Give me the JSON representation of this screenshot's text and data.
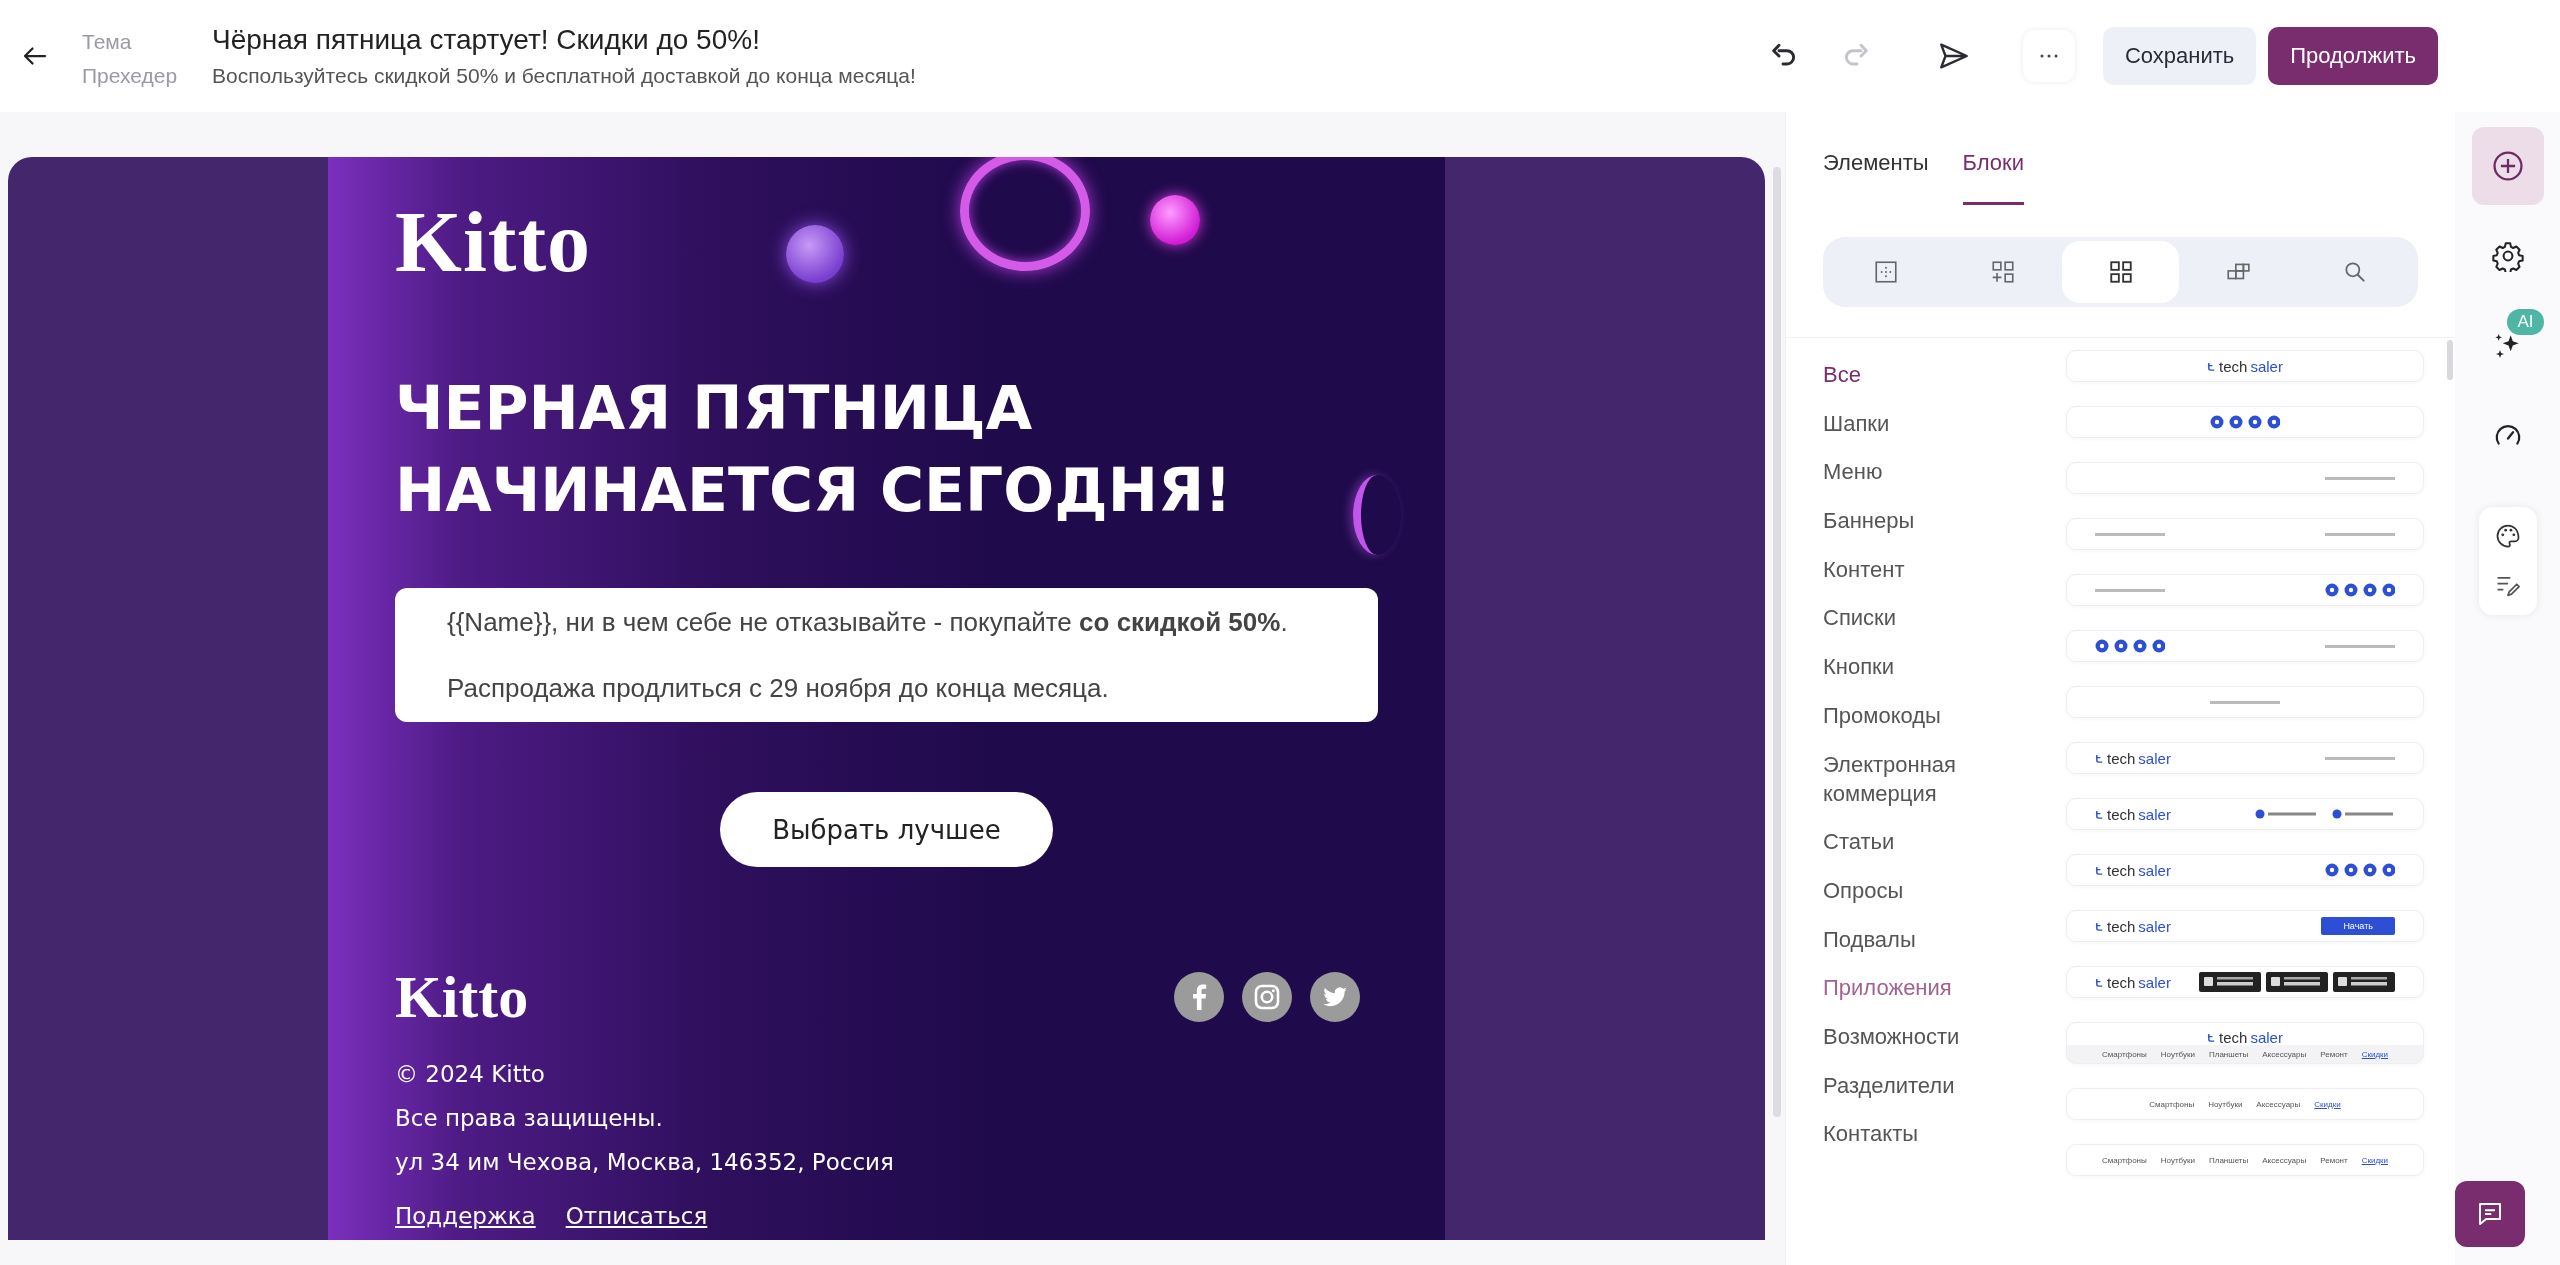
{
  "header": {
    "fields": [
      {
        "label": "Тема",
        "value": "Чёрная пятница стартует! Скидки до 50%!",
        "kind": "title"
      },
      {
        "label": "Прехедер",
        "value": "Воспользуйтесь скидкой 50% и бесплатной доставкой до конца месяца!",
        "kind": "preheader"
      }
    ],
    "history": [
      {
        "kind": "undo",
        "disabled": false
      },
      {
        "kind": "redo",
        "disabled": true
      }
    ],
    "buttons": [
      {
        "label": "Сохранить",
        "kind": "secondary"
      },
      {
        "label": "Продолжить",
        "kind": "primary"
      }
    ]
  },
  "email": {
    "logo": "Kitto",
    "headline": "ЧЕРНАЯ ПЯТНИЦА НАЧИНАЕТСЯ СЕГОДНЯ!",
    "message": [
      "{{Name}}, ни в чем себе не отказывайте - покупайте **со скидкой 50%**.",
      "Распродажа продлиться с 29 ноября до конца месяца."
    ],
    "cta": "Выбрать лучшее",
    "footer": {
      "logo": "Kitto",
      "lines": [
        "© 2024 Kitto",
        "Все права защищены.",
        "ул 34 им Чехова, Москва, 146352, Россия"
      ],
      "links": [
        "Поддержка",
        "Отписаться"
      ]
    }
  },
  "panel": {
    "tabs": [
      {
        "label": "Элементы",
        "selected": false
      },
      {
        "label": "Блоки",
        "selected": true
      }
    ],
    "modes": [
      {
        "kind": "layout",
        "selected": false
      },
      {
        "kind": "add-blocks",
        "selected": false
      },
      {
        "kind": "blocks",
        "selected": true
      },
      {
        "kind": "saved",
        "selected": false
      },
      {
        "kind": "search",
        "selected": false
      }
    ],
    "categories": [
      {
        "label": "Все",
        "selected": true,
        "hovered": false
      },
      {
        "label": "Шапки",
        "selected": false,
        "hovered": false
      },
      {
        "label": "Меню",
        "selected": false,
        "hovered": false
      },
      {
        "label": "Баннеры",
        "selected": false,
        "hovered": false
      },
      {
        "label": "Контент",
        "selected": false,
        "hovered": false
      },
      {
        "label": "Списки",
        "selected": false,
        "hovered": false
      },
      {
        "label": "Кнопки",
        "selected": false,
        "hovered": false
      },
      {
        "label": "Промокоды",
        "selected": false,
        "hovered": false
      },
      {
        "label": "Электронная коммерция",
        "selected": false,
        "hovered": false
      },
      {
        "label": "Статьи",
        "selected": false,
        "hovered": false
      },
      {
        "label": "Опросы",
        "selected": false,
        "hovered": false
      },
      {
        "label": "Подвалы",
        "selected": false,
        "hovered": false
      },
      {
        "label": "Приложения",
        "selected": false,
        "hovered": true
      },
      {
        "label": "Возможности",
        "selected": false,
        "hovered": false
      },
      {
        "label": "Разделители",
        "selected": false,
        "hovered": false
      },
      {
        "label": "Контакты",
        "selected": false,
        "hovered": false
      }
    ],
    "previews": [
      {
        "kind": "centered",
        "parts": [
          {
            "kind": "logo",
            "name": "tech",
            "accent": "saler"
          }
        ]
      },
      {
        "kind": "centered",
        "parts": [
          {
            "kind": "socials"
          }
        ]
      },
      {
        "kind": "right",
        "parts": [
          {
            "kind": "text"
          }
        ]
      },
      {
        "kind": "split",
        "parts": [
          {
            "kind": "text"
          },
          {
            "kind": "text"
          }
        ]
      },
      {
        "kind": "split",
        "parts": [
          {
            "kind": "text"
          },
          {
            "kind": "socials"
          }
        ]
      },
      {
        "kind": "split",
        "parts": [
          {
            "kind": "socials"
          },
          {
            "kind": "text"
          }
        ]
      },
      {
        "kind": "centered",
        "parts": [
          {
            "kind": "text"
          }
        ]
      },
      {
        "kind": "split",
        "parts": [
          {
            "kind": "logo",
            "name": "tech",
            "accent": "saler"
          },
          {
            "kind": "text"
          }
        ]
      },
      {
        "kind": "split",
        "parts": [
          {
            "kind": "logo",
            "name": "tech",
            "accent": "saler"
          },
          {
            "kind": "phones"
          }
        ]
      },
      {
        "kind": "split",
        "parts": [
          {
            "kind": "logo",
            "name": "tech",
            "accent": "saler"
          },
          {
            "kind": "socials"
          }
        ]
      },
      {
        "kind": "split",
        "parts": [
          {
            "kind": "logo",
            "name": "tech",
            "accent": "saler"
          },
          {
            "kind": "button",
            "label": "Начать"
          }
        ]
      },
      {
        "kind": "split",
        "parts": [
          {
            "kind": "logo",
            "name": "tech",
            "accent": "saler"
          },
          {
            "kind": "stores"
          }
        ]
      },
      {
        "kind": "stacked",
        "parts": [
          {
            "kind": "logo",
            "name": "tech",
            "accent": "saler"
          },
          {
            "kind": "menu",
            "items": [
              {
                "label": "Смартфоны",
                "link": false
              },
              {
                "label": "Ноутбуки",
                "link": false
              },
              {
                "label": "Планшеты",
                "link": false
              },
              {
                "label": "Аксессуары",
                "link": false
              },
              {
                "label": "Ремонт",
                "link": false
              },
              {
                "label": "Скидки",
                "link": true
              }
            ]
          }
        ]
      },
      {
        "kind": "centered",
        "parts": [
          {
            "kind": "menu",
            "items": [
              {
                "label": "Смартфоны",
                "link": false
              },
              {
                "label": "Ноутбуки",
                "link": false
              },
              {
                "label": "Аксессуары",
                "link": false
              },
              {
                "label": "Скидки",
                "link": true
              }
            ]
          }
        ]
      },
      {
        "kind": "centered",
        "parts": [
          {
            "kind": "menu",
            "items": [
              {
                "label": "Смартфоны",
                "link": false
              },
              {
                "label": "Ноутбуки",
                "link": false
              },
              {
                "label": "Планшеты",
                "link": false
              },
              {
                "label": "Аксессуары",
                "link": false
              },
              {
                "label": "Ремонт",
                "link": false
              },
              {
                "label": "Скидки",
                "link": true
              }
            ]
          }
        ]
      }
    ]
  },
  "rail": {
    "items": [
      {
        "kind": "add",
        "selected": true
      },
      {
        "kind": "settings",
        "selected": false
      },
      {
        "kind": "ai",
        "badge": "AI",
        "selected": false
      },
      {
        "kind": "speed",
        "selected": false
      }
    ],
    "tools": [
      {
        "kind": "palette",
        "selected": false
      },
      {
        "kind": "edit",
        "selected": false
      }
    ]
  }
}
